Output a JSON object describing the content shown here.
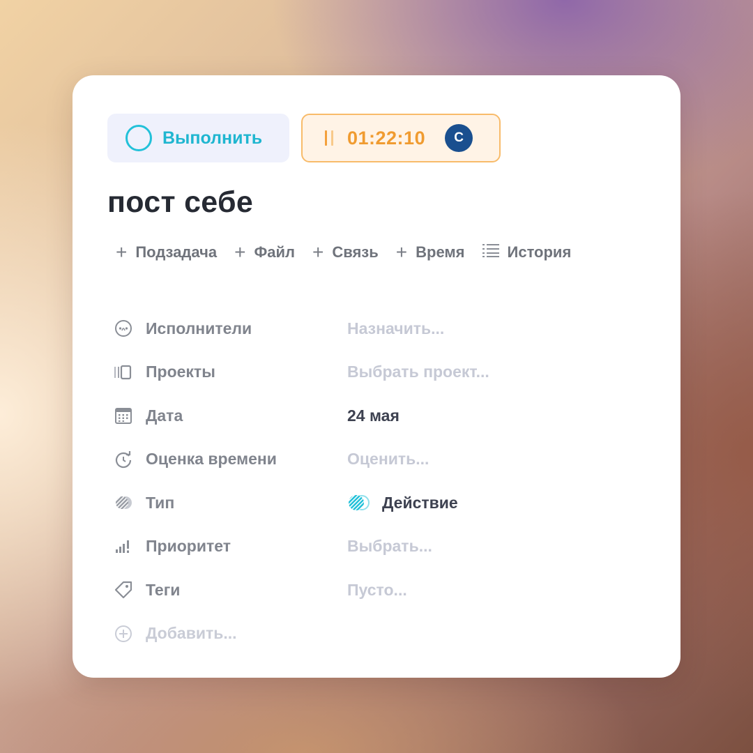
{
  "task": {
    "complete_label": "Выполнить",
    "timer_value": "01:22:10",
    "avatar_initial": "С",
    "title": "пост себе"
  },
  "actions": [
    {
      "label": "Подзадача",
      "icon": "plus-icon"
    },
    {
      "label": "Файл",
      "icon": "plus-icon"
    },
    {
      "label": "Связь",
      "icon": "plus-icon"
    },
    {
      "label": "Время",
      "icon": "plus-icon"
    },
    {
      "label": "История",
      "icon": "list-icon"
    }
  ],
  "properties": [
    {
      "label": "Исполнители",
      "value": "Назначить...",
      "icon": "assignee-icon"
    },
    {
      "label": "Проекты",
      "value": "Выбрать проект...",
      "icon": "projects-icon"
    },
    {
      "label": "Дата",
      "value": "24 мая",
      "icon": "calendar-icon"
    },
    {
      "label": "Оценка времени",
      "value": "Оценить...",
      "icon": "time-estimate-icon"
    },
    {
      "label": "Тип",
      "value": "Действие",
      "icon": "type-icon"
    },
    {
      "label": "Приоритет",
      "value": "Выбрать...",
      "icon": "priority-icon"
    },
    {
      "label": "Теги",
      "value": "Пусто...",
      "icon": "tag-icon"
    }
  ],
  "add_label": "Добавить...",
  "colors": {
    "accent_cyan": "#22c1d9",
    "timer_orange": "#f09b30",
    "avatar_blue": "#1a4f8f",
    "placeholder": "#c6c9d5"
  }
}
